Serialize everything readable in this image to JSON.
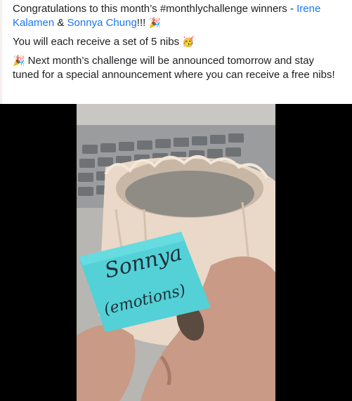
{
  "post": {
    "line1_prefix": "Congratulations to this month’s #monthlychallenge winners - ",
    "winner_1": "Irene Kalamen",
    "amp": " & ",
    "winner_2": "Sonnya Chung",
    "line1_suffix": "!!! ",
    "party_emoji_1": "🎉",
    "line2": "You will each receive a set of 5 nibs ",
    "face_emoji": "🥳",
    "party_emoji_2": "🎉",
    "line3": " Next month’s challenge will be announced tomorrow and stay tuned for a special announcement where you can receive a free nibs!"
  },
  "video": {
    "note_line1": "Sonnya",
    "note_line2": "(emotions)"
  },
  "colors": {
    "link": "#1877f2",
    "note": "#53d1d6",
    "vase": "#ead9c8"
  }
}
